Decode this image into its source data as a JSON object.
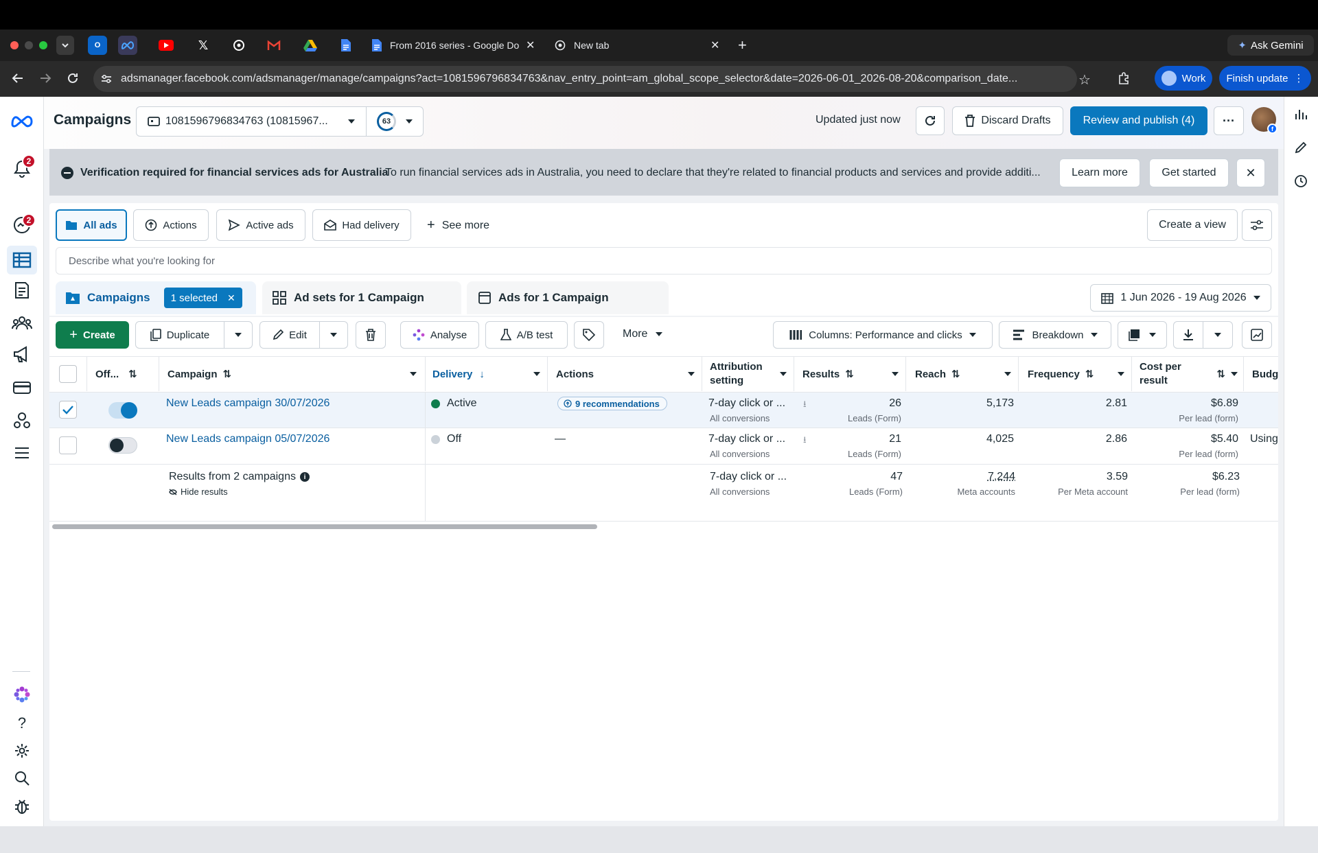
{
  "browser": {
    "tabs": [
      {
        "label": "From 2016 series - Google Do"
      },
      {
        "label": "New tab"
      }
    ],
    "ask_gemini": "Ask Gemini",
    "url": "adsmanager.facebook.com/adsmanager/manage/campaigns?act=1081596796834763&nav_entry_point=am_global_scope_selector&date=2026-06-01_2026-08-20&comparison_date...",
    "profile_label": "Work",
    "finish_update": "Finish update"
  },
  "header": {
    "title": "Campaigns",
    "account": "1081596796834763 (10815967...",
    "score": "63",
    "updated": "Updated just now",
    "discard": "Discard Drafts",
    "review": "Review and publish (4)",
    "more": "···"
  },
  "leftnav": {
    "badge_notifications": "2",
    "badge_messages": "2"
  },
  "banner": {
    "title": "Verification required for financial services ads for Australia",
    "text": "To run financial services ads in Australia, you need to declare that they're related to financial products and services and provide additi...",
    "learn_more": "Learn more",
    "get_started": "Get started"
  },
  "filters": {
    "all_ads": "All ads",
    "actions": "Actions",
    "active_ads": "Active ads",
    "had_delivery": "Had delivery",
    "see_more": "See more",
    "create_view": "Create a view"
  },
  "search": {
    "placeholder": "Describe what you're looking for"
  },
  "level_tabs": {
    "campaigns": "Campaigns",
    "selected": "1 selected",
    "ad_sets": "Ad sets for 1 Campaign",
    "ads": "Ads for 1 Campaign",
    "date_range": "1 Jun 2026 - 19 Aug 2026"
  },
  "toolbar": {
    "create": "Create",
    "duplicate": "Duplicate",
    "edit": "Edit",
    "analyse": "Analyse",
    "ab_test": "A/B test",
    "more": "More",
    "columns": "Columns: Performance and clicks",
    "breakdown": "Breakdown"
  },
  "table": {
    "headers": {
      "offon": "Off...",
      "campaign": "Campaign",
      "delivery": "Delivery",
      "actions": "Actions",
      "attribution_1": "Attribution",
      "attribution_2": "setting",
      "results": "Results",
      "reach": "Reach",
      "frequency": "Frequency",
      "cost_1": "Cost per",
      "cost_2": "result",
      "budget": "Budg"
    },
    "rows": [
      {
        "campaign": "New Leads campaign 30/07/2026",
        "delivery": "Active",
        "actions": "9 recommendations",
        "attribution": "7-day click or ...",
        "attribution_sub": "All conversions",
        "results": "26",
        "results_sub": "Leads (Form)",
        "reach": "5,173",
        "frequency": "2.81",
        "cost": "$6.89",
        "cost_sub": "Per lead (form)",
        "budget": "",
        "checked": true,
        "on": true
      },
      {
        "campaign": "New Leads campaign 05/07/2026",
        "delivery": "Off",
        "actions": "—",
        "attribution": "7-day click or ...",
        "attribution_sub": "All conversions",
        "results": "21",
        "results_sub": "Leads (Form)",
        "reach": "4,025",
        "frequency": "2.86",
        "cost": "$5.40",
        "cost_sub": "Per lead (form)",
        "budget": "Using",
        "checked": false,
        "on": false
      }
    ],
    "summary": {
      "label": "Results from 2 campaigns",
      "hide": "Hide results",
      "attribution": "7-day click or ...",
      "attribution_sub": "All conversions",
      "results": "47",
      "results_sub": "Leads (Form)",
      "reach": "7,244",
      "reach_sub": "Meta accounts",
      "frequency": "3.59",
      "frequency_sub": "Per Meta account",
      "cost": "$6.23",
      "cost_sub": "Per lead (form)"
    }
  },
  "colors": {
    "accent_blue": "#0a78be",
    "create_green": "#0f7d4d",
    "active_dot": "#0f7d4d",
    "badge_red": "#c3112a"
  }
}
